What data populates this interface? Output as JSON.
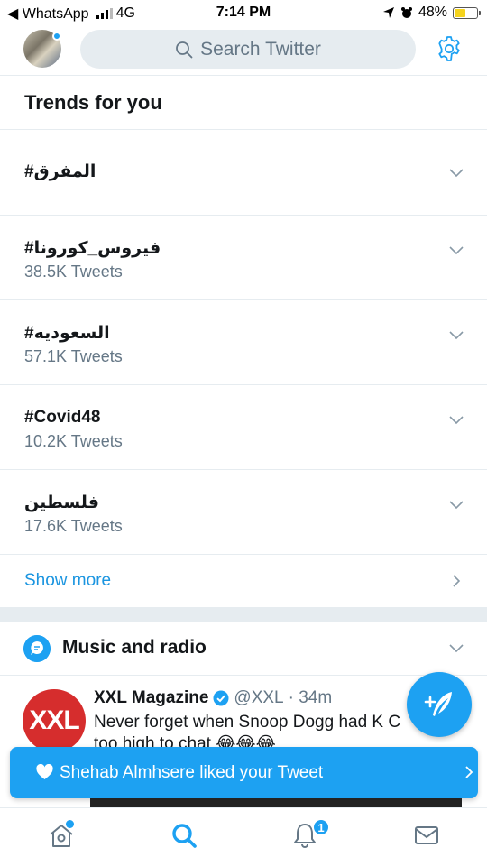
{
  "status_bar": {
    "back_app": "◀ WhatsApp",
    "network": "4G",
    "time": "7:14 PM",
    "battery": "48%",
    "battery_level": 0.48
  },
  "header": {
    "search_placeholder": "Search Twitter"
  },
  "trends": {
    "title": "Trends for you",
    "items": [
      {
        "name": "#المفرق",
        "count": ""
      },
      {
        "name": "#فيروس_كورونا",
        "count": "38.5K Tweets"
      },
      {
        "name": "#السعوديه",
        "count": "57.1K Tweets"
      },
      {
        "name": "#Covid48",
        "count": "10.2K Tweets"
      },
      {
        "name": "فلسطين",
        "count": "17.6K Tweets"
      }
    ],
    "show_more": "Show more"
  },
  "music": {
    "title": "Music and radio"
  },
  "tweet": {
    "author": "XXL Magazine",
    "handle": "@XXL",
    "time": "· 34m",
    "line1": "Never forget when Snoop Dogg had K C",
    "line2": "too high to chat 😂😂😂",
    "logo_text": "XXL"
  },
  "toast": {
    "message": "Shehab Almhsere liked your Tweet"
  },
  "tab_bar": {
    "notifications_badge": "1"
  },
  "colors": {
    "accent": "#1da1f2",
    "link": "#1b95e0",
    "secondary_text": "#657786",
    "divider": "#e6ecf0"
  }
}
